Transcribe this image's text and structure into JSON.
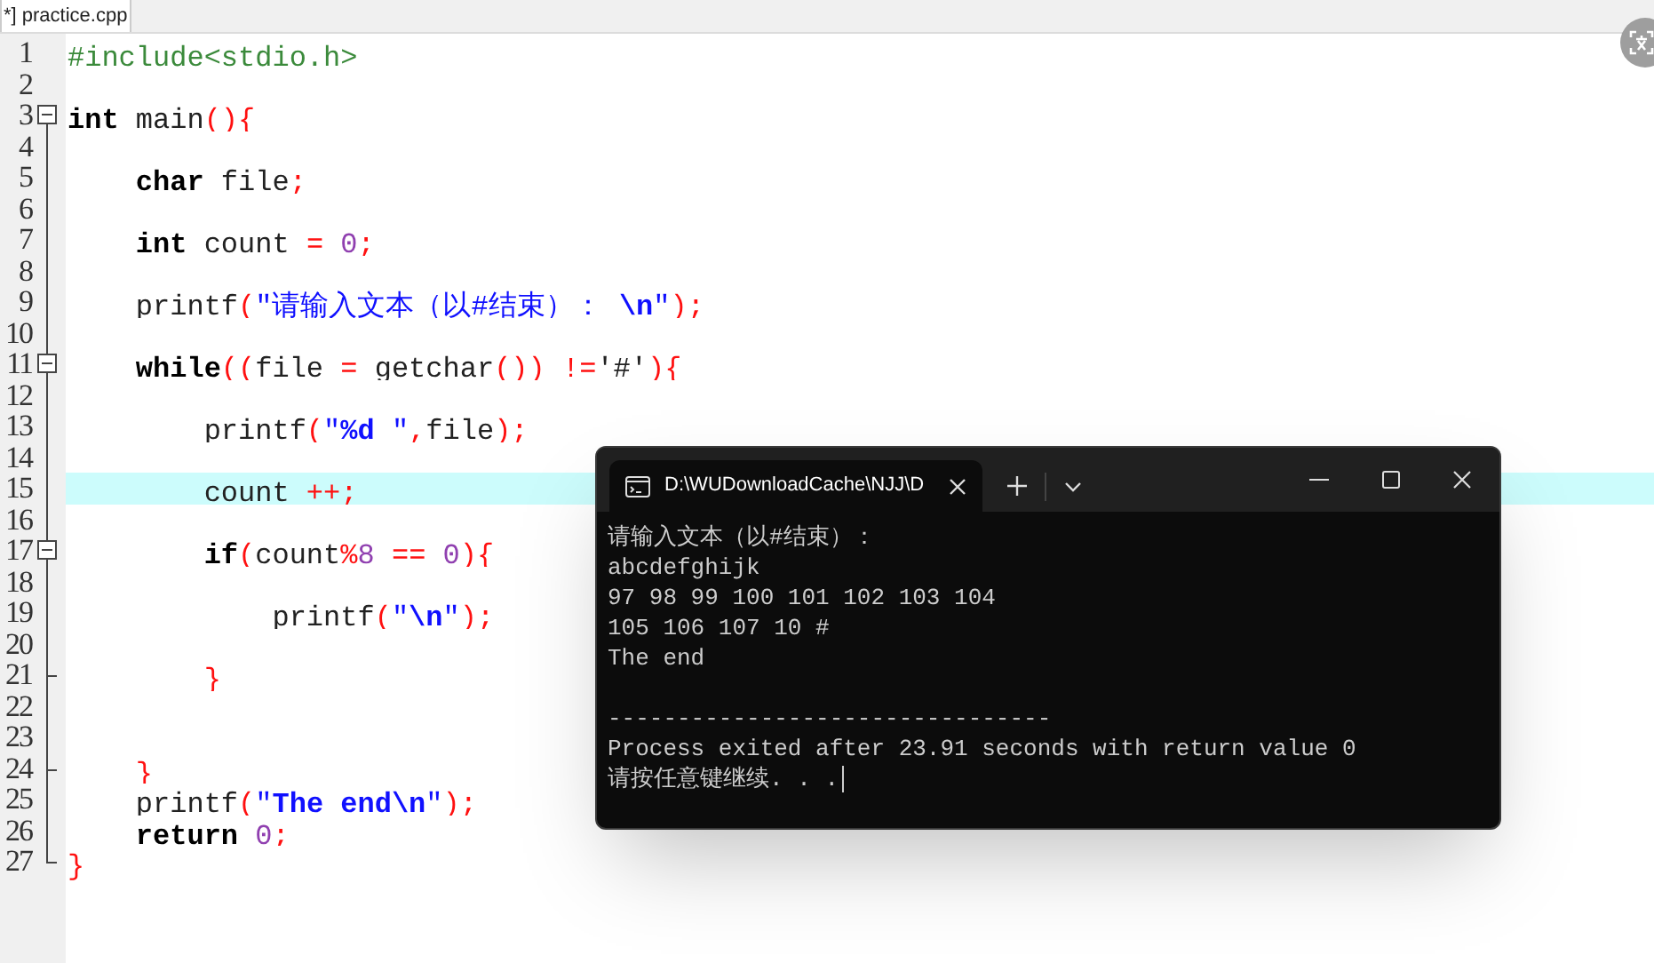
{
  "editor": {
    "tab": {
      "label": "*] practice.cpp",
      "selected": true
    },
    "lines": [
      {
        "number": "1",
        "fold_start": false,
        "fold_end": false,
        "current": false,
        "tokens": [
          {
            "kind": "preproc",
            "text": "#include<stdio.h>"
          }
        ]
      },
      {
        "number": "2",
        "fold_start": false,
        "fold_end": false,
        "current": false
      },
      {
        "number": "3",
        "fold_start": true,
        "fold_end": false,
        "current": false,
        "tokens": [
          {
            "kind": "keyword",
            "text": "int"
          },
          {
            "kind": "plain",
            "text": " main"
          },
          {
            "kind": "symbol",
            "text": "(){"
          }
        ]
      },
      {
        "number": "4",
        "fold_start": false,
        "fold_end": false,
        "current": false
      },
      {
        "number": "5",
        "fold_start": false,
        "fold_end": false,
        "current": false,
        "tokens": [
          {
            "kind": "keyword",
            "text": "    char"
          },
          {
            "kind": "plain",
            "text": " file"
          },
          {
            "kind": "symbol",
            "text": ";"
          }
        ]
      },
      {
        "number": "6",
        "fold_start": false,
        "fold_end": false,
        "current": false
      },
      {
        "number": "7",
        "fold_start": false,
        "fold_end": false,
        "current": false,
        "tokens": [
          {
            "kind": "keyword",
            "text": "    int"
          },
          {
            "kind": "plain",
            "text": " count "
          },
          {
            "kind": "symbol",
            "text": "= "
          },
          {
            "kind": "number",
            "text": "0"
          },
          {
            "kind": "symbol",
            "text": ";"
          }
        ]
      },
      {
        "number": "8",
        "fold_start": false,
        "fold_end": false,
        "current": false
      },
      {
        "number": "9",
        "fold_start": false,
        "fold_end": false,
        "current": false,
        "tokens": [
          {
            "kind": "plain",
            "text": "    printf"
          },
          {
            "kind": "symbol",
            "text": "("
          },
          {
            "kind": "string",
            "text": "\"请输入文本（以#结束）： "
          },
          {
            "kind": "format",
            "text": "\\n"
          },
          {
            "kind": "string",
            "text": "\""
          },
          {
            "kind": "symbol",
            "text": ");"
          }
        ]
      },
      {
        "number": "10",
        "fold_start": false,
        "fold_end": false,
        "current": false
      },
      {
        "number": "11",
        "fold_start": true,
        "fold_end": false,
        "current": false,
        "tokens": [
          {
            "kind": "keyword",
            "text": "    while"
          },
          {
            "kind": "symbol",
            "text": "(("
          },
          {
            "kind": "plain",
            "text": "file "
          },
          {
            "kind": "symbol",
            "text": "="
          },
          {
            "kind": "plain",
            "text": " getchar"
          },
          {
            "kind": "symbol",
            "text": "())"
          },
          {
            "kind": "symbol",
            "text": " !="
          },
          {
            "kind": "plain",
            "text": "'#'"
          },
          {
            "kind": "symbol",
            "text": "){"
          }
        ]
      },
      {
        "number": "12",
        "fold_start": false,
        "fold_end": false,
        "current": false
      },
      {
        "number": "13",
        "fold_start": false,
        "fold_end": false,
        "current": false,
        "tokens": [
          {
            "kind": "plain",
            "text": "        printf"
          },
          {
            "kind": "symbol",
            "text": "("
          },
          {
            "kind": "string",
            "text": "\""
          },
          {
            "kind": "format",
            "text": "%d"
          },
          {
            "kind": "string",
            "text": " \""
          },
          {
            "kind": "symbol",
            "text": ","
          },
          {
            "kind": "plain",
            "text": "file"
          },
          {
            "kind": "symbol",
            "text": ");"
          }
        ]
      },
      {
        "number": "14",
        "fold_start": false,
        "fold_end": false,
        "current": false
      },
      {
        "number": "15",
        "fold_start": false,
        "fold_end": false,
        "current": true,
        "tokens": [
          {
            "kind": "plain",
            "text": "        count "
          },
          {
            "kind": "symbol",
            "text": "++;"
          }
        ]
      },
      {
        "number": "16",
        "fold_start": false,
        "fold_end": false,
        "current": false
      },
      {
        "number": "17",
        "fold_start": true,
        "fold_end": false,
        "current": false,
        "tokens": [
          {
            "kind": "keyword",
            "text": "        if"
          },
          {
            "kind": "symbol",
            "text": "("
          },
          {
            "kind": "plain",
            "text": "count"
          },
          {
            "kind": "symbol",
            "text": "%"
          },
          {
            "kind": "number",
            "text": "8"
          },
          {
            "kind": "symbol",
            "text": " == "
          },
          {
            "kind": "number",
            "text": "0"
          },
          {
            "kind": "symbol",
            "text": "){"
          }
        ]
      },
      {
        "number": "18",
        "fold_start": false,
        "fold_end": false,
        "current": false
      },
      {
        "number": "19",
        "fold_start": false,
        "fold_end": false,
        "current": false,
        "tokens": [
          {
            "kind": "plain",
            "text": "            printf"
          },
          {
            "kind": "symbol",
            "text": "("
          },
          {
            "kind": "string",
            "text": "\""
          },
          {
            "kind": "format",
            "text": "\\n"
          },
          {
            "kind": "string",
            "text": "\""
          },
          {
            "kind": "symbol",
            "text": ");"
          }
        ]
      },
      {
        "number": "20",
        "fold_start": false,
        "fold_end": false,
        "current": false
      },
      {
        "number": "21",
        "fold_start": false,
        "fold_end": true,
        "current": false,
        "tokens": [
          {
            "kind": "symbol",
            "text": "        }"
          }
        ]
      },
      {
        "number": "22",
        "fold_start": false,
        "fold_end": false,
        "current": false
      },
      {
        "number": "23",
        "fold_start": false,
        "fold_end": false,
        "current": false
      },
      {
        "number": "24",
        "fold_start": false,
        "fold_end": true,
        "current": false,
        "tokens": [
          {
            "kind": "symbol",
            "text": "    }"
          }
        ]
      },
      {
        "number": "25",
        "fold_start": false,
        "fold_end": false,
        "current": false,
        "tokens": [
          {
            "kind": "plain",
            "text": "    printf"
          },
          {
            "kind": "symbol",
            "text": "("
          },
          {
            "kind": "string",
            "text": "\""
          },
          {
            "kind": "format",
            "text": "The end\\n"
          },
          {
            "kind": "string",
            "text": "\""
          },
          {
            "kind": "symbol",
            "text": ");"
          }
        ]
      },
      {
        "number": "26",
        "fold_start": false,
        "fold_end": false,
        "current": false,
        "tokens": [
          {
            "kind": "keyword",
            "text": "    return"
          },
          {
            "kind": "number",
            "text": " 0"
          },
          {
            "kind": "symbol",
            "text": ";"
          }
        ]
      },
      {
        "number": "27",
        "fold_start": false,
        "fold_end": true,
        "current": false,
        "tokens": [
          {
            "kind": "symbol",
            "text": "}"
          }
        ]
      }
    ]
  },
  "terminal": {
    "tab_title": "D:\\WUDownloadCache\\NJJ\\D",
    "output": [
      "请输入文本（以#结束）：",
      "abcdefghijk",
      "97 98 99 100 101 102 103 104",
      "105 106 107 10 #",
      "The end"
    ],
    "footer": [
      "--------------------------------",
      "Process exited after 23.91 seconds with return value 0",
      "请按任意键继续. . ."
    ],
    "cursor_visible": true
  }
}
